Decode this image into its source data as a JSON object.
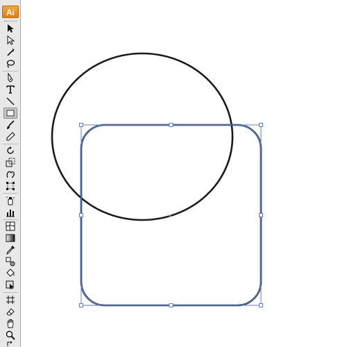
{
  "app": {
    "logo_text": "Ai",
    "logo_color": "#f39c26",
    "selection_color": "#5b7fd6"
  },
  "tools": [
    {
      "name": "selection-tool-icon"
    },
    {
      "name": "direct-selection-tool-icon"
    },
    {
      "name": "magic-wand-tool-icon"
    },
    {
      "name": "lasso-tool-icon"
    },
    {
      "name": "pen-tool-icon"
    },
    {
      "name": "type-tool-icon"
    },
    {
      "name": "line-segment-tool-icon"
    },
    {
      "name": "rectangle-tool-icon",
      "selected": true
    },
    {
      "name": "paintbrush-tool-icon"
    },
    {
      "name": "pencil-tool-icon"
    },
    {
      "name": "rotate-tool-icon"
    },
    {
      "name": "scale-tool-icon"
    },
    {
      "name": "warp-tool-icon"
    },
    {
      "name": "free-transform-tool-icon"
    },
    {
      "name": "symbol-sprayer-tool-icon"
    },
    {
      "name": "column-graph-tool-icon"
    },
    {
      "name": "mesh-tool-icon"
    },
    {
      "name": "gradient-tool-icon"
    },
    {
      "name": "eyedropper-tool-icon"
    },
    {
      "name": "blend-tool-icon"
    },
    {
      "name": "live-paint-bucket-tool-icon"
    },
    {
      "name": "live-paint-selection-tool-icon"
    },
    {
      "name": "slice-tool-icon"
    },
    {
      "name": "eraser-tool-icon"
    },
    {
      "name": "hand-tool-icon"
    },
    {
      "name": "zoom-tool-icon"
    }
  ]
}
